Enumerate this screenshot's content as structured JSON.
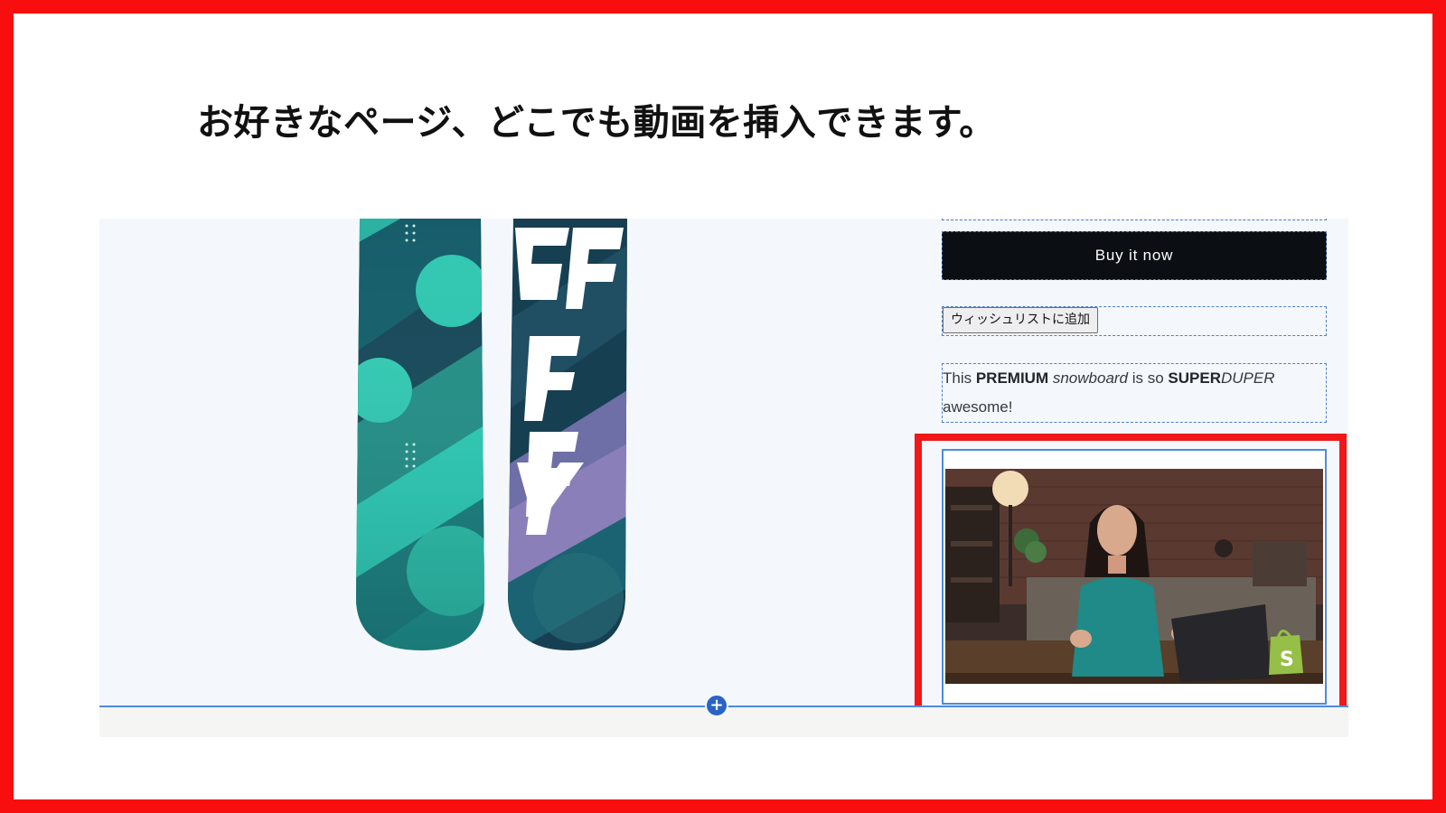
{
  "headline": "お好きなページ、どこでも動画を挿入できます。",
  "product_form": {
    "buy_now_label": "Buy it now",
    "wishlist_label": "ウィッシュリストに追加"
  },
  "description": {
    "part1": "This ",
    "part2": "PREMIUM",
    "part3": " snowboard",
    "part4": " is so ",
    "part5": "SUPER",
    "part6": "DUPER",
    "part7": "awesome!"
  },
  "editor": {
    "add_section_symbol": "+"
  },
  "colors": {
    "frame_red": "#f80e0e",
    "selection_blue": "#4f8bdc",
    "button_dark": "#0b0f13",
    "board_teal": "#33cdb4",
    "board_navy": "#163f52"
  },
  "icons": {
    "add": "plus-icon",
    "brand": "shopify-bag-icon"
  }
}
